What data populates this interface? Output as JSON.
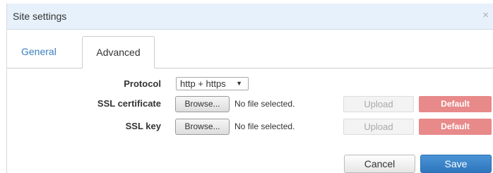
{
  "dialog": {
    "title": "Site settings",
    "close_glyph": "×"
  },
  "tabs": [
    {
      "label": "General",
      "active": false
    },
    {
      "label": "Advanced",
      "active": true
    }
  ],
  "protocol": {
    "label": "Protocol",
    "selected": "http + https",
    "caret": "▼"
  },
  "ssl_certificate": {
    "label": "SSL certificate",
    "browse_label": "Browse...",
    "file_status": "No file selected.",
    "upload_label": "Upload",
    "default_label": "Default"
  },
  "ssl_key": {
    "label": "SSL key",
    "browse_label": "Browse...",
    "file_status": "No file selected.",
    "upload_label": "Upload",
    "default_label": "Default"
  },
  "footer": {
    "cancel_label": "Cancel",
    "save_label": "Save"
  },
  "colors": {
    "titlebar_bg": "#e7f1fb",
    "link_blue": "#3a7fc1",
    "default_red": "#e8898a",
    "save_blue": "#2f76bd"
  }
}
